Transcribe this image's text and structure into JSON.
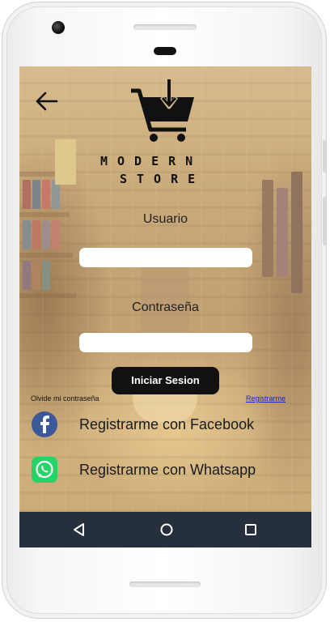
{
  "header": {
    "back_icon": "arrow-left-icon",
    "logo_icon": "shopping-cart-download-icon",
    "logo_line1": "MODERN",
    "logo_line2": "STORE"
  },
  "form": {
    "username_label": "Usuario",
    "username_value": "",
    "password_label": "Contraseña",
    "password_value": "",
    "login_button": "Iniciar Sesion",
    "forgot_password": "Olvide mi contraseña",
    "register_link": "Registrarme"
  },
  "social": {
    "facebook_label": "Registrarme con Facebook",
    "whatsapp_label": "Registrarme con Whatsapp",
    "facebook_color": "#3b5998",
    "whatsapp_color": "#25d366"
  },
  "navbar": {
    "back_icon": "triangle-back-icon",
    "home_icon": "circle-home-icon",
    "recents_icon": "square-recents-icon",
    "color": "#26303d"
  }
}
